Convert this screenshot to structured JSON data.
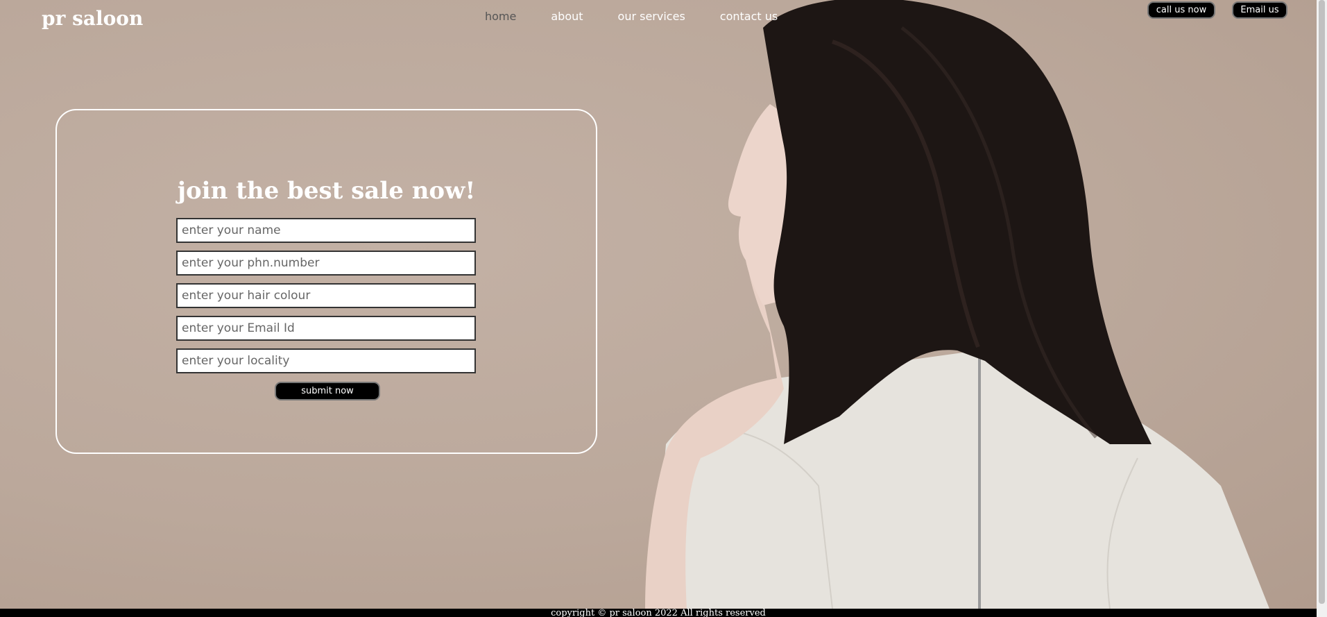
{
  "brand": {
    "logo": "pr saloon"
  },
  "nav": {
    "items": [
      "home",
      "about",
      "our services",
      "contact us"
    ]
  },
  "top_buttons": {
    "call": "call us now",
    "email": "Email us"
  },
  "form": {
    "title": "join the best sale now!",
    "fields": [
      {
        "placeholder": "enter your name"
      },
      {
        "placeholder": "enter your phn.number"
      },
      {
        "placeholder": "enter your hair colour"
      },
      {
        "placeholder": "enter your Email Id"
      },
      {
        "placeholder": "enter your locality"
      }
    ],
    "submit": "submit now"
  },
  "footer": {
    "text": "copyright © pr saloon 2022 All rights reserved"
  },
  "colors": {
    "background": "#c0ada1",
    "button": "#000000",
    "nav_active": "#555555",
    "text": "#ffffff"
  }
}
